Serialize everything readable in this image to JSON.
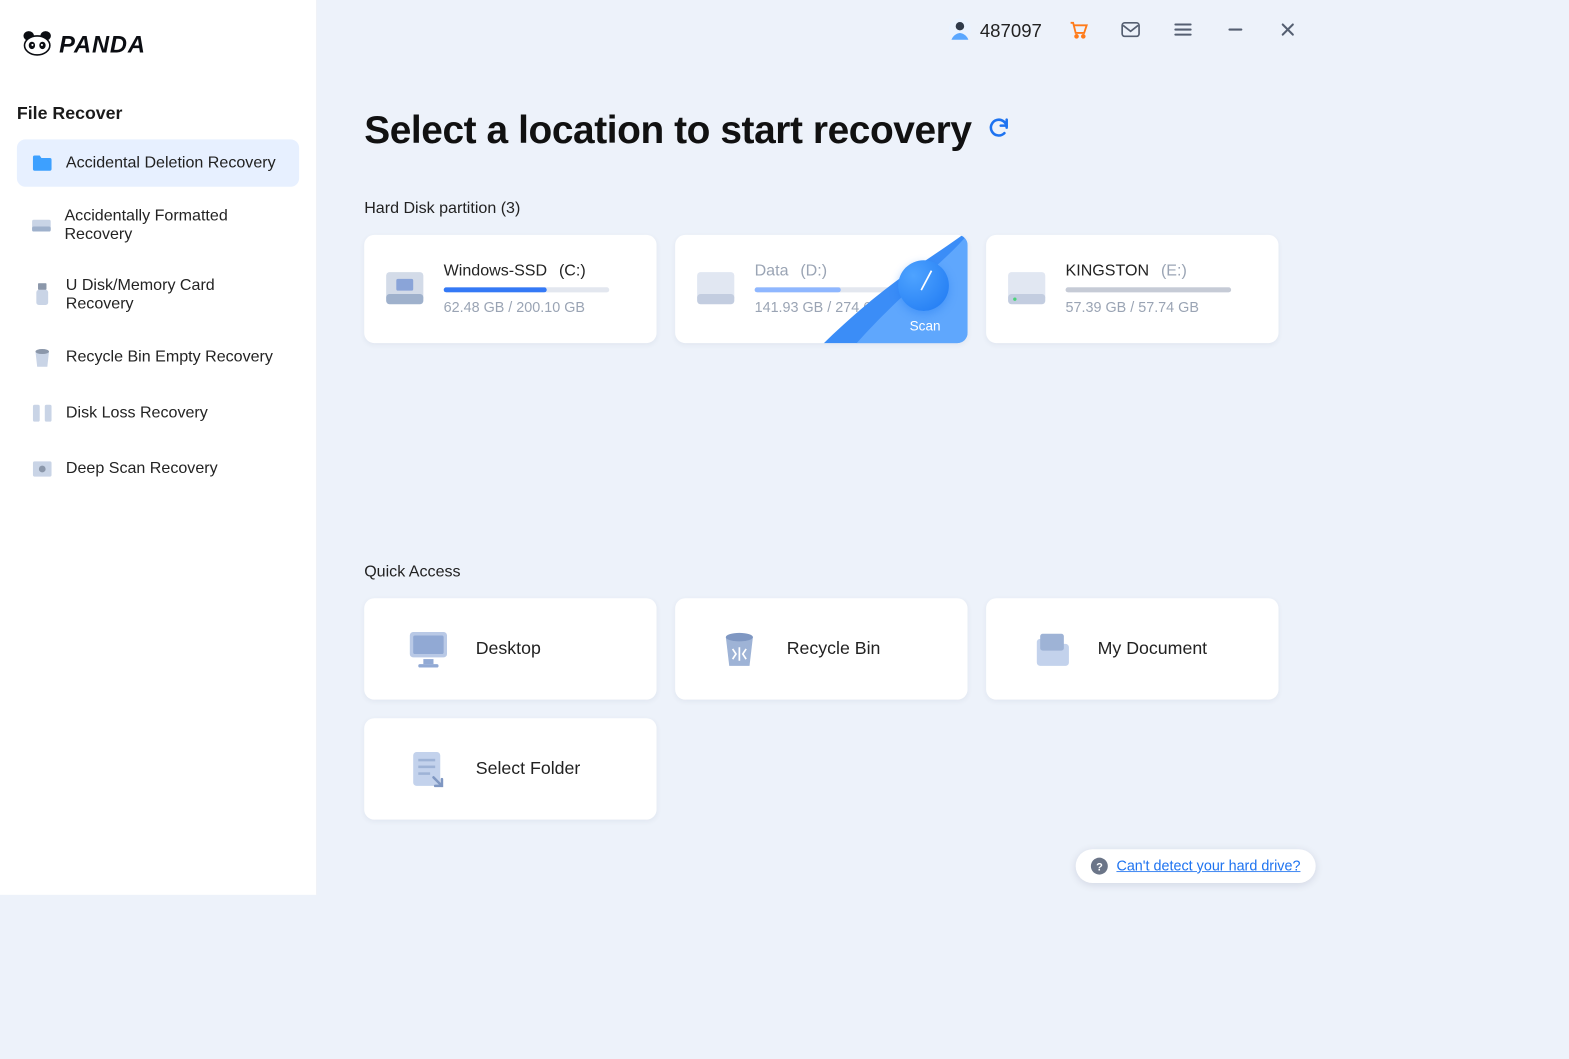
{
  "app_name": "PANDA",
  "header": {
    "user_id": "487097"
  },
  "sidebar": {
    "section_title": "File Recover",
    "items": [
      {
        "label": "Accidental Deletion Recovery"
      },
      {
        "label": "Accidentally Formatted Recovery"
      },
      {
        "label": "U Disk/Memory Card Recovery"
      },
      {
        "label": "Recycle Bin Empty Recovery"
      },
      {
        "label": "Disk Loss Recovery"
      },
      {
        "label": "Deep Scan Recovery"
      }
    ]
  },
  "main": {
    "title": "Select a location to start recovery",
    "partitions_heading": "Hard Disk partition   (3)",
    "partitions": [
      {
        "name": "Windows-SSD",
        "letter": "(C:)",
        "size": "62.48 GB / 200.10 GB",
        "fill_pct": 62
      },
      {
        "name": "Data",
        "letter": "(D:)",
        "size": "141.93 GB / 274.62 GB",
        "fill_pct": 52,
        "scan_label": "Scan"
      },
      {
        "name": "KINGSTON",
        "letter": "(E:)",
        "size": "57.39 GB / 57.74 GB",
        "fill_pct": 100
      }
    ],
    "quick_heading": "Quick Access",
    "quick": [
      {
        "label": "Desktop"
      },
      {
        "label": "Recycle Bin"
      },
      {
        "label": "My Document"
      },
      {
        "label": "Select Folder"
      }
    ],
    "help_link": "Can't detect your hard drive?"
  }
}
